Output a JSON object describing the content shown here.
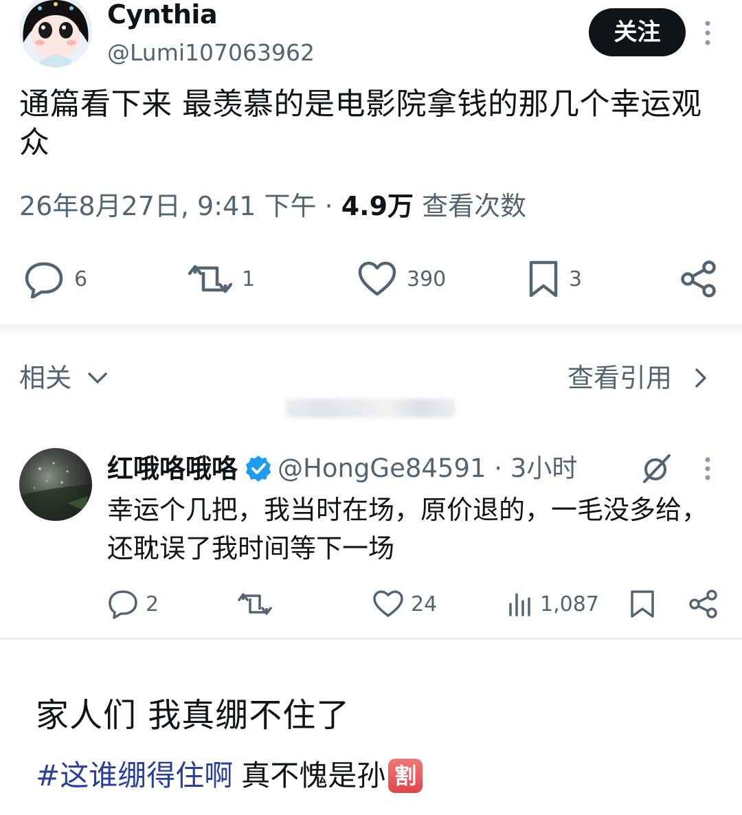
{
  "post": {
    "author_name": "Cynthia",
    "author_handle": "@Lumi107063962",
    "follow_label": "关注",
    "text": "通篇看下来 最羡慕的是电影院拿钱的那几个幸运观众",
    "timestamp": "26年8月27日, 9:41 下午",
    "separator": " · ",
    "views_count": "4.9万",
    "views_label": " 查看次数",
    "actions": {
      "replies": "6",
      "reposts": "1",
      "likes": "390",
      "bookmarks": "3"
    }
  },
  "related": {
    "label": "相关",
    "view_quotes_label": "查看引用"
  },
  "reply": {
    "name": "红哦咯哦咯",
    "handle_time": "@HongGe84591 · 3小时",
    "text": "幸运个几把，我当时在场，原价退的，一毛没多给，还耽误了我时间等下一场",
    "actions": {
      "replies": "2",
      "reposts": "",
      "likes": "24",
      "views": "1,087"
    }
  },
  "caption": {
    "text": "家人们 我真绷不住了",
    "hashtag": "#这谁绷得住啊",
    "rest": "真不愧是孙",
    "emoji_char": "割"
  },
  "colors": {
    "text_primary": "#0f1419",
    "text_secondary": "#536471",
    "verified_blue": "#1d9bf0",
    "hashtag_blue": "#2a3f9d",
    "emoji_red": "#e0474b"
  },
  "icons": {
    "reply": "speech-bubble-icon",
    "repost": "repost-arrows-icon",
    "like": "heart-icon",
    "bookmark": "bookmark-icon",
    "share": "share-nodes-icon",
    "views": "bar-chart-icon",
    "grok": "grok-slash-icon",
    "more": "vertical-dots-icon",
    "verified": "verified-badge-icon",
    "chevron_down": "chevron-down-icon",
    "chevron_right": "chevron-right-icon"
  }
}
